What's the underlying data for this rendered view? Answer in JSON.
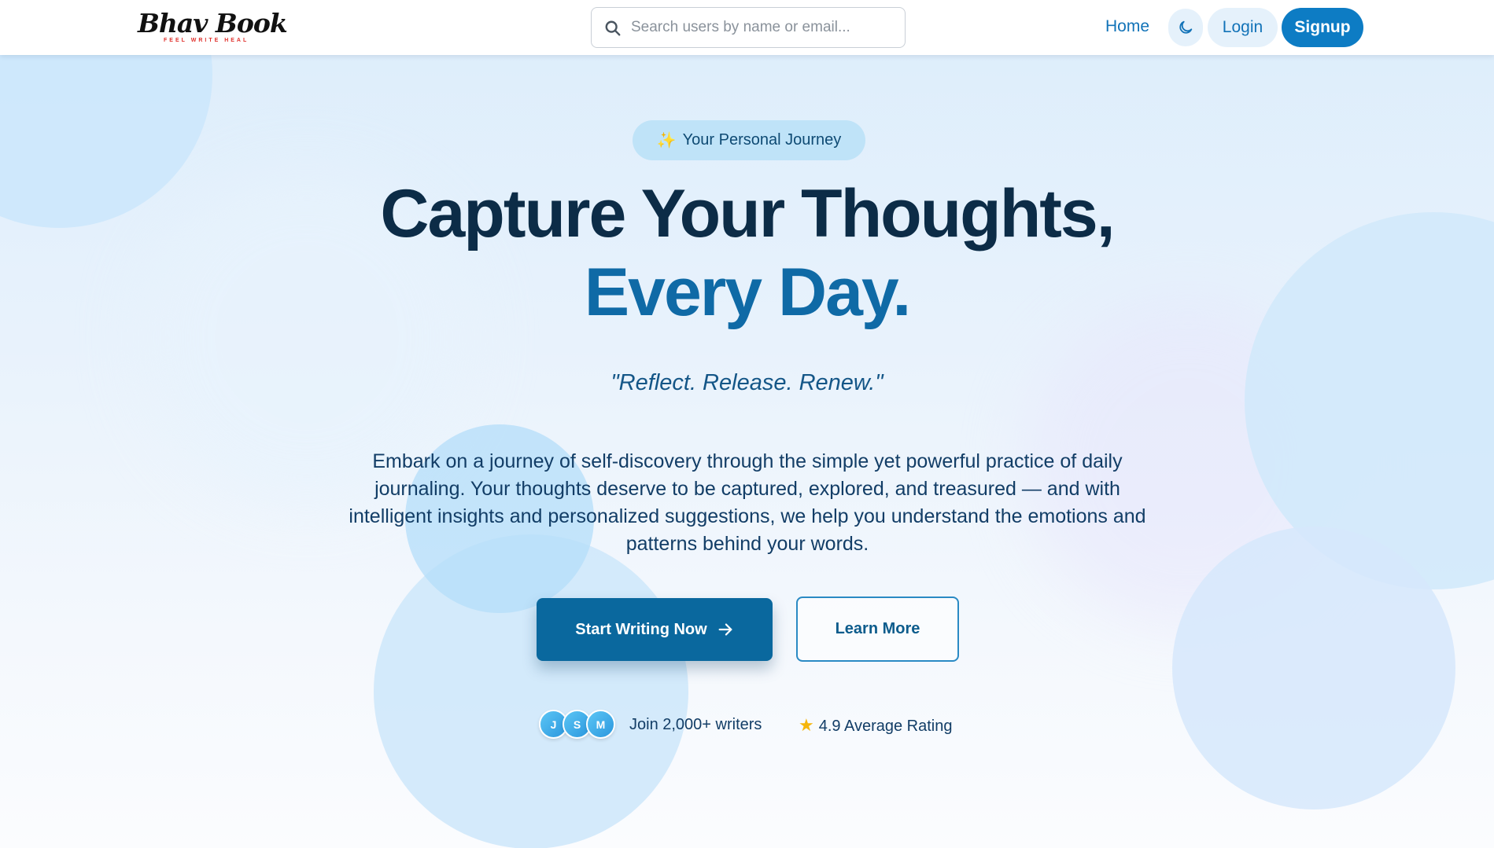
{
  "brand": {
    "name": "Bhav Book",
    "tagline": "FEEL WRITE HEAL"
  },
  "nav": {
    "search_placeholder": "Search users by name or email...",
    "search_icon": "search-icon",
    "home_label": "Home",
    "theme_icon": "moon-icon",
    "login_label": "Login",
    "signup_label": "Signup"
  },
  "hero": {
    "badge_icon": "✨",
    "badge_label": "Your Personal Journey",
    "headline_underlined": "Capture",
    "headline_rest": " Your Thoughts,",
    "headline_line2": "Every Day.",
    "quote": "\"Reflect. Release. Renew.\"",
    "description": "Embark on a journey of self-discovery through the simple yet powerful practice of daily journaling. Your thoughts deserve to be captured, explored, and treasured — and with intelligent insights and personalized suggestions, we help you understand the emotions and patterns behind your words.",
    "primary_button": "Start Writing Now",
    "secondary_button": "Learn More"
  },
  "social_proof": {
    "avatars": [
      "J",
      "S",
      "M"
    ],
    "join_text": "Join 2,000+ writers",
    "star_icon": "★",
    "rating_text": "4.9 Average Rating"
  },
  "colors": {
    "accent": "#0d7cc4",
    "primary_button": "#0a689e",
    "headline_dark": "#0c2c47",
    "headline_blue": "#0f6aa6",
    "logo_tagline": "#e0322d",
    "star": "#f5b50a"
  }
}
